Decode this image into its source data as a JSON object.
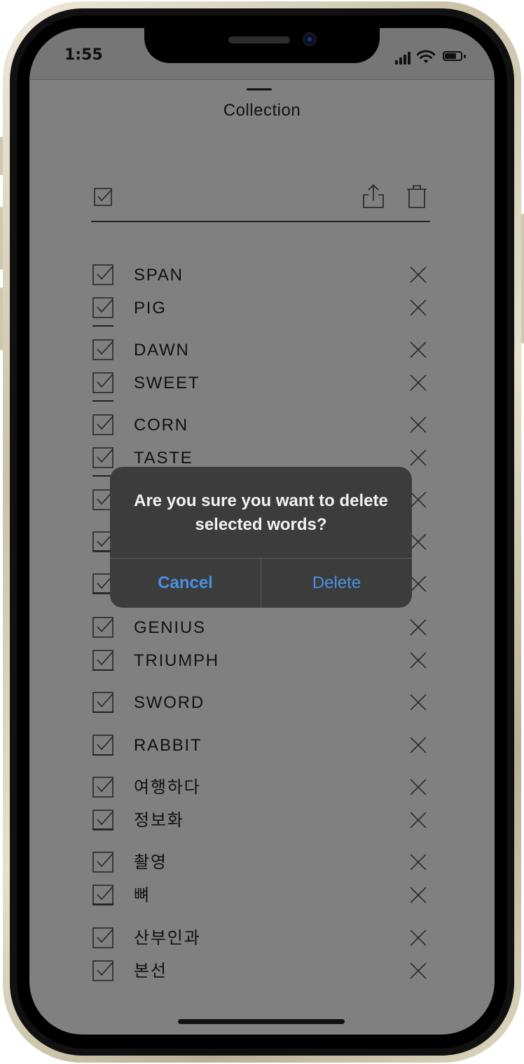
{
  "status_bar": {
    "time": "1:55"
  },
  "sheet": {
    "title": "Collection"
  },
  "toolbar": {
    "select_all_icon": "checkbox-checked-icon",
    "share_icon": "share-icon",
    "delete_icon": "trash-icon"
  },
  "words": [
    {
      "label": "SPAN",
      "checked": true
    },
    {
      "label": "PIG",
      "checked": true
    },
    {
      "label": "DAWN",
      "checked": true
    },
    {
      "label": "SWEET",
      "checked": true
    },
    {
      "label": "CORN",
      "checked": true
    },
    {
      "label": "TASTE",
      "checked": true
    },
    {
      "label": "",
      "checked": true
    },
    {
      "label": "",
      "checked": true
    },
    {
      "label": "",
      "checked": true
    },
    {
      "label": "GENIUS",
      "checked": true
    },
    {
      "label": "TRIUMPH",
      "checked": true
    },
    {
      "label": "SWORD",
      "checked": true
    },
    {
      "label": "RABBIT",
      "checked": true
    },
    {
      "label": "여행하다",
      "checked": true
    },
    {
      "label": "정보화",
      "checked": true
    },
    {
      "label": "촬영",
      "checked": true
    },
    {
      "label": "뼈",
      "checked": true
    },
    {
      "label": "산부인과",
      "checked": true
    },
    {
      "label": "본선",
      "checked": true
    }
  ],
  "alert": {
    "message": "Are you sure you want to delete selected words?",
    "cancel_label": "Cancel",
    "delete_label": "Delete",
    "accent_color": "#4a90e2"
  }
}
